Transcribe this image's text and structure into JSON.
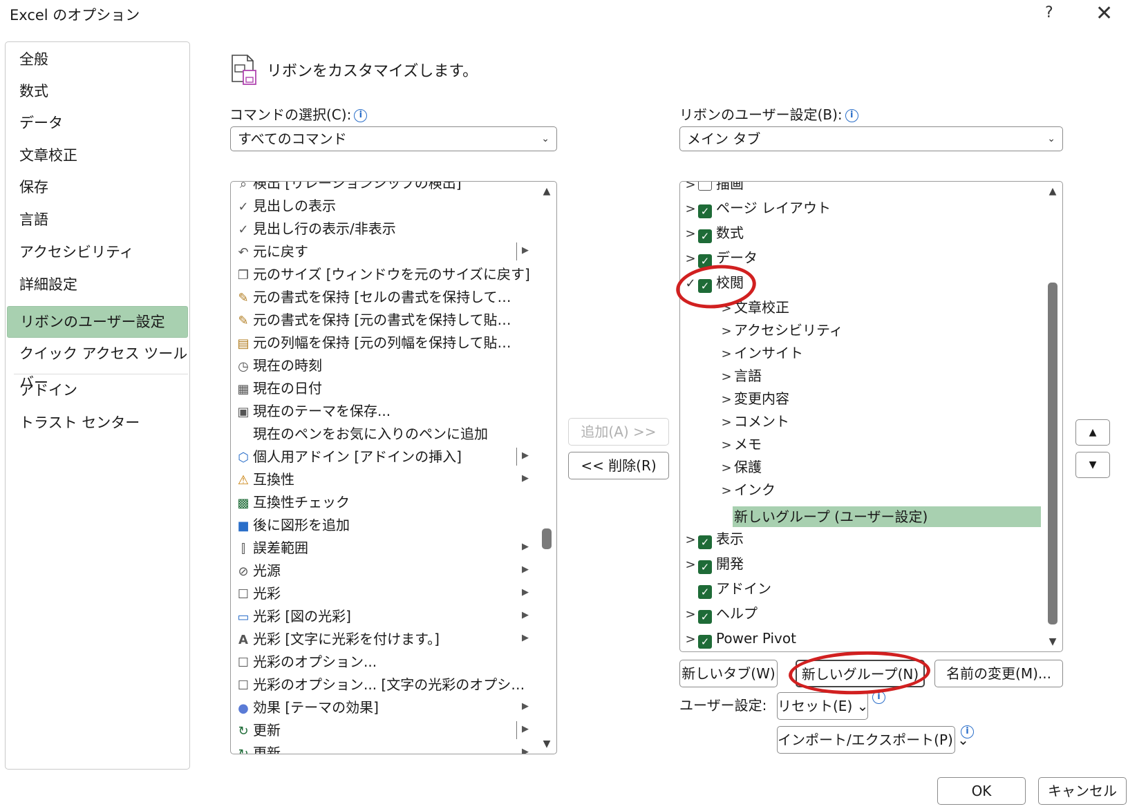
{
  "window": {
    "title": "Excel のオプション",
    "help": "?",
    "close": "✕"
  },
  "nav": {
    "items": [
      {
        "label": "全般"
      },
      {
        "label": "数式"
      },
      {
        "label": "データ"
      },
      {
        "label": "文章校正"
      },
      {
        "label": "保存"
      },
      {
        "label": "言語"
      },
      {
        "label": "アクセシビリティ"
      },
      {
        "label": "詳細設定"
      },
      {
        "label": "リボンのユーザー設定",
        "selected": true
      },
      {
        "label": "クイック アクセス ツール バー"
      },
      {
        "label": "アドイン"
      },
      {
        "label": "トラスト センター"
      }
    ]
  },
  "header": {
    "text": "リボンをカスタマイズします。"
  },
  "commands": {
    "label": "コマンドの選択(C):",
    "selected": "すべてのコマンド",
    "items": [
      {
        "icon": "search",
        "label": "検出 [リレーションシップの検出]"
      },
      {
        "icon": "check",
        "label": "見出しの表示"
      },
      {
        "icon": "check",
        "label": "見出し行の表示/非表示"
      },
      {
        "icon": "undo",
        "label": "元に戻す",
        "split": true
      },
      {
        "icon": "restore",
        "label": "元のサイズ [ウィンドウを元のサイズに戻す]"
      },
      {
        "icon": "format-brush",
        "label": "元の書式を保持 [セルの書式を保持して…"
      },
      {
        "icon": "format-brush",
        "label": "元の書式を保持 [元の書式を保持して貼…"
      },
      {
        "icon": "column-width",
        "label": "元の列幅を保持 [元の列幅を保持して貼…"
      },
      {
        "icon": "clock",
        "label": "現在の時刻"
      },
      {
        "icon": "calendar",
        "label": "現在の日付"
      },
      {
        "icon": "save-theme",
        "label": "現在のテーマを保存..."
      },
      {
        "icon": "",
        "label": "現在のペンをお気に入りのペンに追加"
      },
      {
        "icon": "addin",
        "label": "個人用アドイン [アドインの挿入]",
        "split": true
      },
      {
        "icon": "compat",
        "label": "互換性",
        "arrow": true
      },
      {
        "icon": "compat-check",
        "label": "互換性チェック"
      },
      {
        "icon": "shape-after",
        "label": "後に図形を追加"
      },
      {
        "icon": "error-bars",
        "label": "誤差範囲",
        "arrow": true
      },
      {
        "icon": "light",
        "label": "光源",
        "arrow": true
      },
      {
        "icon": "glow-box",
        "label": "光彩",
        "arrow": true
      },
      {
        "icon": "picture-glow",
        "label": "光彩 [図の光彩]",
        "arrow": true
      },
      {
        "icon": "text-glow",
        "label": "光彩 [文字に光彩を付けます。]",
        "arrow": true
      },
      {
        "icon": "glow-box",
        "label": "光彩のオプション..."
      },
      {
        "icon": "glow-box",
        "label": "光彩のオプション... [文字の光彩のオプシ…"
      },
      {
        "icon": "effects",
        "label": "効果 [テーマの効果]",
        "arrow": true
      },
      {
        "icon": "refresh",
        "label": "更新",
        "split": true
      },
      {
        "icon": "refresh",
        "label": "更新",
        "arrow": true
      }
    ]
  },
  "middle": {
    "add": "追加(A) >>",
    "remove": "<< 削除(R)"
  },
  "ribbon": {
    "label": "リボンのユーザー設定(B):",
    "selected": "メイン タブ",
    "tree": [
      {
        "level": 0,
        "twisty": ">",
        "checkbox": false,
        "label": "描画"
      },
      {
        "level": 0,
        "twisty": ">",
        "checkbox": true,
        "label": "ページ レイアウト"
      },
      {
        "level": 0,
        "twisty": ">",
        "checkbox": true,
        "label": "数式"
      },
      {
        "level": 0,
        "twisty": ">",
        "checkbox": true,
        "label": "データ"
      },
      {
        "level": 0,
        "twisty": "✓",
        "checkbox": true,
        "label": "校閲"
      },
      {
        "level": 1,
        "twisty": ">",
        "label": "文章校正"
      },
      {
        "level": 1,
        "twisty": ">",
        "label": "アクセシビリティ"
      },
      {
        "level": 1,
        "twisty": ">",
        "label": "インサイト"
      },
      {
        "level": 1,
        "twisty": ">",
        "label": "言語"
      },
      {
        "level": 1,
        "twisty": ">",
        "label": "変更内容"
      },
      {
        "level": 1,
        "twisty": ">",
        "label": "コメント"
      },
      {
        "level": 1,
        "twisty": ">",
        "label": "メモ"
      },
      {
        "level": 1,
        "twisty": ">",
        "label": "保護"
      },
      {
        "level": 1,
        "twisty": ">",
        "label": "インク"
      },
      {
        "level": 1,
        "twisty": "",
        "label": "新しいグループ (ユーザー設定)",
        "selected": true
      },
      {
        "level": 0,
        "twisty": ">",
        "checkbox": true,
        "label": "表示"
      },
      {
        "level": 0,
        "twisty": ">",
        "checkbox": true,
        "label": "開発"
      },
      {
        "level": 0,
        "twisty": "",
        "checkbox": true,
        "label": "アドイン"
      },
      {
        "level": 0,
        "twisty": ">",
        "checkbox": true,
        "label": "ヘルプ"
      },
      {
        "level": 0,
        "twisty": ">",
        "checkbox": true,
        "label": "Power Pivot"
      }
    ],
    "new_tab": "新しいタブ(W)",
    "new_group": "新しいグループ(N)",
    "rename": "名前の変更(M)...",
    "custom_label": "ユーザー設定:",
    "reset": "リセット(E) ⌄",
    "import_export": "インポート/エクスポート(P) ⌄",
    "move_up": "▲",
    "move_down": "▼"
  },
  "footer": {
    "ok": "OK",
    "cancel": "キャンセル"
  },
  "colors": {
    "selected_bg": "#a8d0b0",
    "checkbox": "#1e6b37",
    "highlight": "#d12020"
  }
}
